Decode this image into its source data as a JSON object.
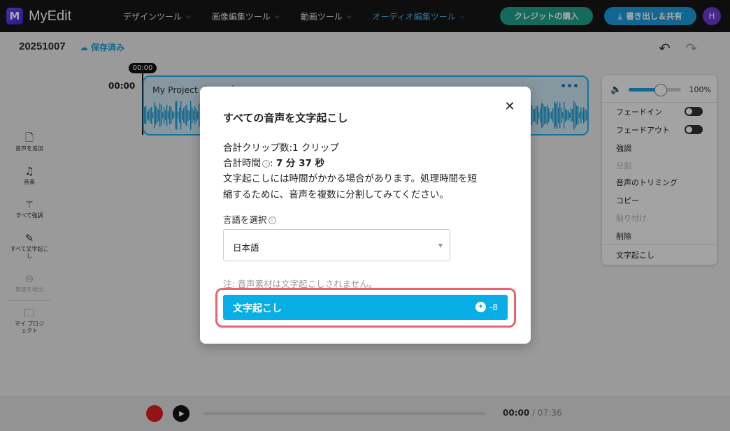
{
  "app": {
    "logo_letter": "M",
    "name": "MyEdit"
  },
  "nav": {
    "items": [
      {
        "label": "デザインツール"
      },
      {
        "label": "画像編集ツール"
      },
      {
        "label": "動画ツール"
      },
      {
        "label": "オーディオ編集ツール"
      }
    ],
    "buy_credits": "クレジットの購入",
    "export": "書き出し＆共有",
    "avatar_initial": "H"
  },
  "project": {
    "name": "20251007",
    "saved": "保存済み"
  },
  "sidebar": {
    "items": [
      {
        "label": "音声を追加",
        "icon": "add-audio-icon"
      },
      {
        "label": "音楽",
        "icon": "music-icon"
      },
      {
        "label": "すべて強調",
        "icon": "magic-wand-icon"
      },
      {
        "label": "すべて文字起こし",
        "icon": "transcribe-icon"
      },
      {
        "label": "無音を検出",
        "icon": "silence-icon"
      },
      {
        "label": "マイ プロジェクト",
        "icon": "folder-icon"
      }
    ]
  },
  "timeline": {
    "start_label": "00:00",
    "playhead": "00:00",
    "clip_title": "My Project（07:36）"
  },
  "context_menu": {
    "volume": "100%",
    "volume_fraction": 0.62,
    "items": {
      "fade_in": "フェードイン",
      "fade_out": "フェードアウト",
      "enhance": "強調",
      "split": "分割",
      "trim": "音声のトリミング",
      "copy": "コピー",
      "paste": "貼り付け",
      "delete": "削除",
      "transcribe": "文字起こし"
    }
  },
  "player": {
    "current": "00:00",
    "separator": " / ",
    "total": "07:36"
  },
  "modal": {
    "title": "すべての音声を文字起こし",
    "clip_count": "合計クリップ数:1 クリップ",
    "duration_label": "合計時間",
    "duration_value": "7 分 37 秒",
    "warning_line1": "文字起こしには時間がかかる場合があります。処理時間を短",
    "warning_line2": "縮するために、音声を複数に分割してみてください。",
    "language_label": "言語を選択",
    "language_value": "日本語",
    "note": "注: 音声素材は文字起こしされません。",
    "button": "文字起こし",
    "credit_cost": "-8"
  }
}
